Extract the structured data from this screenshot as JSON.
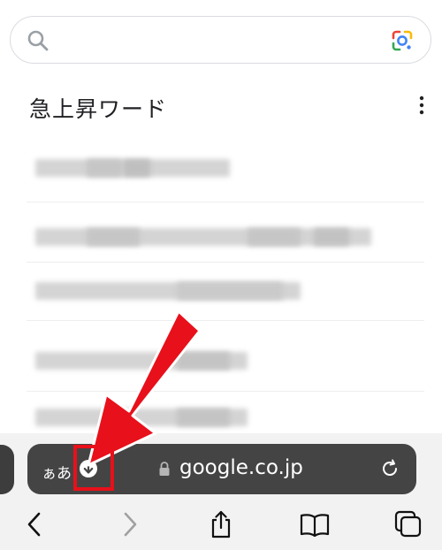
{
  "search": {
    "placeholder": ""
  },
  "trending": {
    "title": "急上昇ワード"
  },
  "address_bar": {
    "aa_label": "ぁあ",
    "url": "google.co.jp"
  },
  "icons": {
    "search": "search-icon",
    "lens": "google-lens-icon",
    "more": "more-vertical-icon",
    "download": "download-icon",
    "lock": "lock-icon",
    "reload": "reload-icon",
    "back": "chevron-left-icon",
    "forward": "chevron-right-icon",
    "share": "share-icon",
    "bookmarks": "book-icon",
    "tabs": "tabs-icon"
  },
  "colors": {
    "highlight": "#e8101a",
    "address_bar": "#444444"
  }
}
